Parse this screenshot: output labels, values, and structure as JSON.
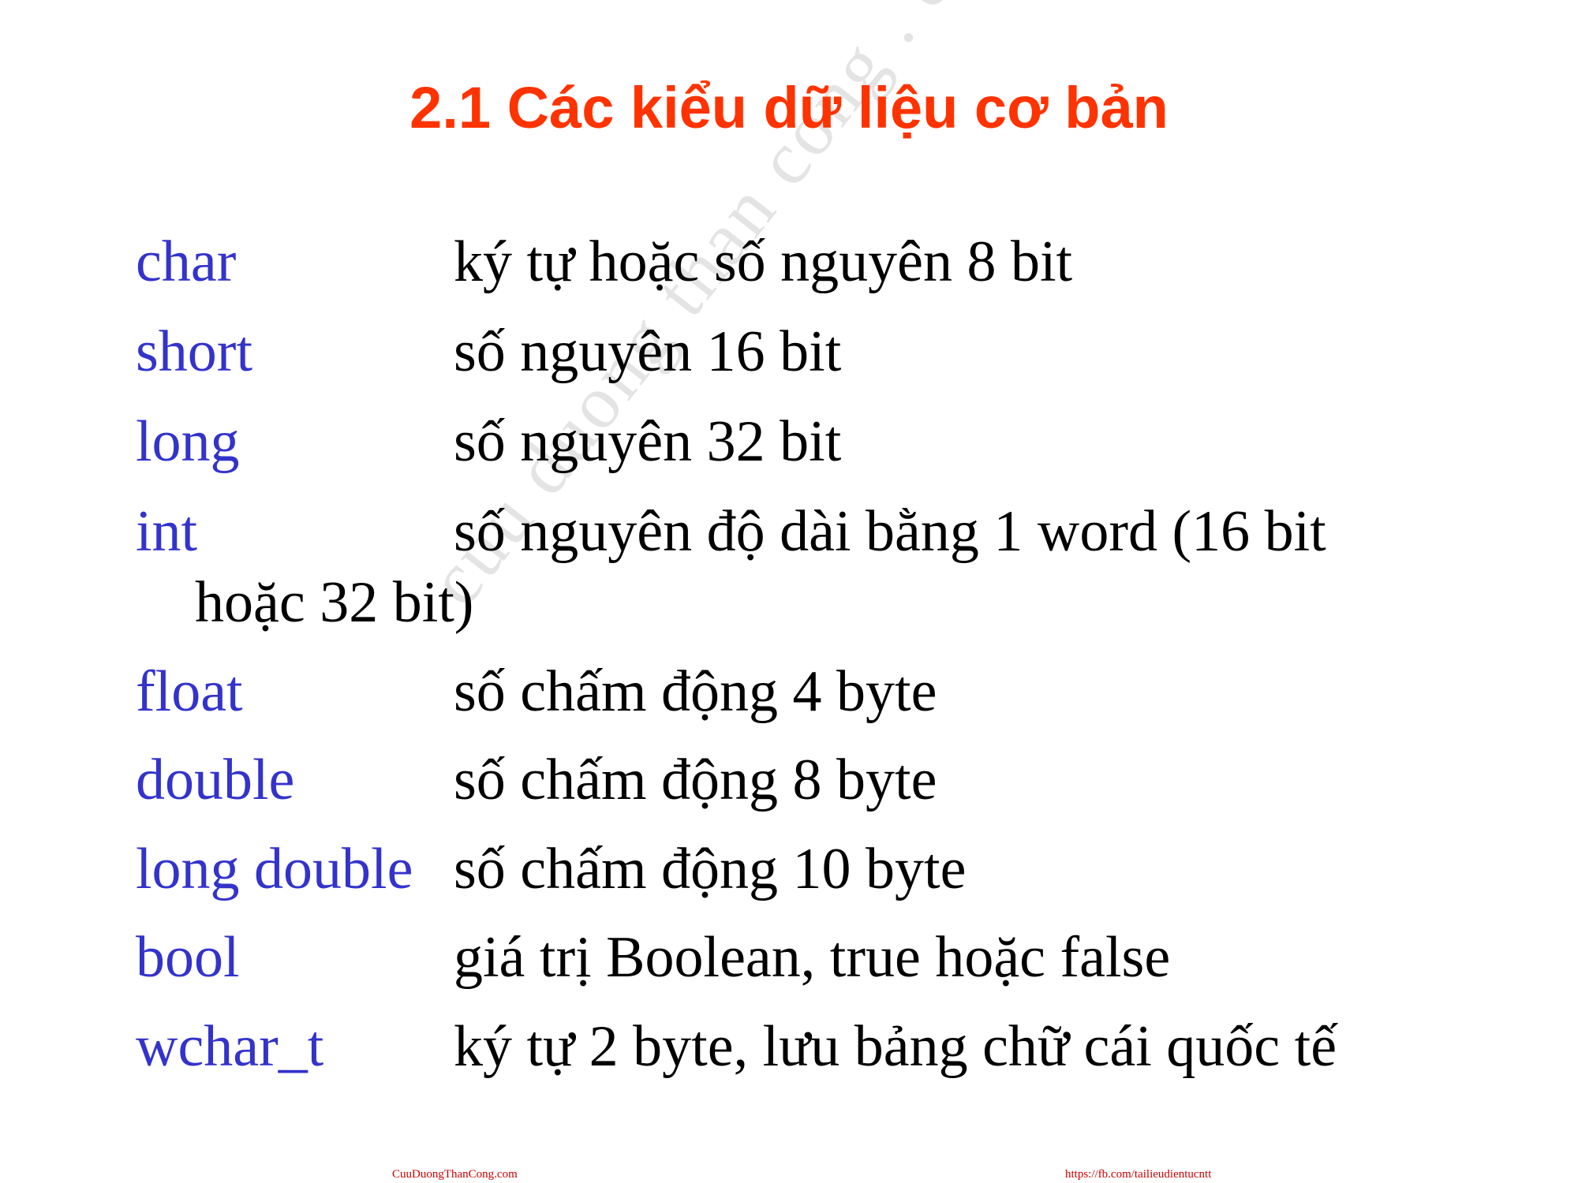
{
  "slide": {
    "title": "2.1 Các kiểu dữ liệu cơ bản",
    "watermark": "cuu duong than cong . com",
    "rows": [
      {
        "type": "char",
        "desc": "ký tự hoặc số nguyên 8 bit"
      },
      {
        "type": "short",
        "desc": "số nguyên 16 bit"
      },
      {
        "type": "long",
        "desc": "số nguyên 32 bit"
      },
      {
        "type": "int",
        "desc": "số nguyên độ dài bằng 1 word (16 bit",
        "continuation": "hoặc 32 bit)"
      },
      {
        "type": "float",
        "desc": "số chấm động 4 byte"
      },
      {
        "type": "double",
        "desc": "số chấm động 8 byte"
      },
      {
        "type": "long double",
        "desc": "số chấm động 10 byte"
      },
      {
        "type": "bool",
        "desc": "giá trị Boolean, true hoặc false"
      },
      {
        "type": "wchar_t",
        "desc": "ký tự 2 byte, lưu bảng chữ cái quốc tế"
      }
    ],
    "footer": {
      "left": "CuuDuongThanCong.com",
      "right": "https://fb.com/tailieudientucntt"
    }
  },
  "colors": {
    "title": "#ff3300",
    "type_keyword": "#3333cc",
    "description": "#000000",
    "footer": "#cc0000",
    "watermark": "#e4e4e4"
  }
}
